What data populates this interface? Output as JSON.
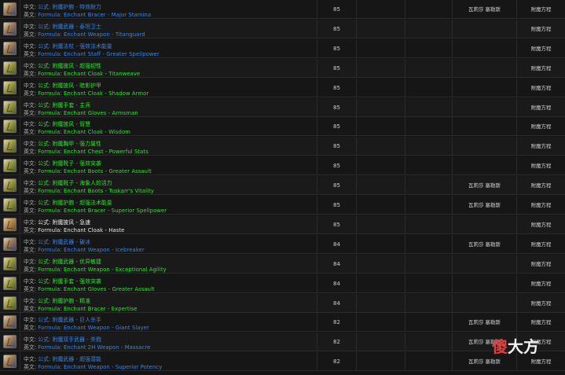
{
  "labels": {
    "cn_prefix": "中文:",
    "en_prefix": "英文:"
  },
  "rows": [
    {
      "cn": "公式: 附魔护腕 - 特效耐力",
      "en": "Formula: Enchant Bracer - Major Stamina",
      "level": "85",
      "source": "瓦莉莎 塞勒斯",
      "type": "附魔方程",
      "quality": "blue"
    },
    {
      "cn": "公式: 附魔武器 - 泰坦卫士",
      "en": "Formula: Enchant Weapon - Titanguard",
      "level": "85",
      "source": "",
      "type": "附魔方程",
      "quality": "blue"
    },
    {
      "cn": "公式: 附魔法杖 - 强效法术能量",
      "en": "Formula: Enchant Staff - Greater Spellpower",
      "level": "85",
      "source": "",
      "type": "附魔方程",
      "quality": "blue"
    },
    {
      "cn": "公式: 附魔披风 - 超强韧性",
      "en": "Formula: Enchant Cloak - Titanweave",
      "level": "85",
      "source": "",
      "type": "附魔方程",
      "quality": "green"
    },
    {
      "cn": "公式: 附魔披风 - 暗影护甲",
      "en": "Formula: Enchant Cloak - Shadow Armor",
      "level": "85",
      "source": "",
      "type": "附魔方程",
      "quality": "green"
    },
    {
      "cn": "公式: 附魔手套 - 主兵",
      "en": "Formula: Enchant Gloves - Armsman",
      "level": "85",
      "source": "",
      "type": "附魔方程",
      "quality": "green"
    },
    {
      "cn": "公式: 附魔披风 - 智慧",
      "en": "Formula: Enchant Cloak - Wisdom",
      "level": "85",
      "source": "",
      "type": "附魔方程",
      "quality": "green"
    },
    {
      "cn": "公式: 附魔胸甲 - 强力属性",
      "en": "Formula: Enchant Chest - Powerful Stats",
      "level": "85",
      "source": "",
      "type": "附魔方程",
      "quality": "green"
    },
    {
      "cn": "公式: 附魔靴子 - 强效突袭",
      "en": "Formula: Enchant Boots - Greater Assault",
      "level": "85",
      "source": "",
      "type": "附魔方程",
      "quality": "green"
    },
    {
      "cn": "公式: 附魔靴子 - 海象人的活力",
      "en": "Formula: Enchant Boots - Tuskarr's Vitality",
      "level": "85",
      "source": "瓦莉莎 塞勒斯",
      "type": "附魔方程",
      "quality": "green"
    },
    {
      "cn": "公式: 附魔护腕 - 超强法术能量",
      "en": "Formula: Enchant Bracer - Superior Spellpower",
      "level": "85",
      "source": "瓦莉莎 塞勒斯",
      "type": "附魔方程",
      "quality": "green"
    },
    {
      "cn": "公式: 附魔披风 - 急速",
      "en": "Formula: Enchant Cloak - Haste",
      "level": "85",
      "source": "",
      "type": "附魔方程",
      "quality": "white"
    },
    {
      "cn": "公式: 附魔武器 - 破冰",
      "en": "Formula: Enchant Weapon - Icebreaker",
      "level": "84",
      "source": "瓦莉莎 塞勒斯",
      "type": "附魔方程",
      "quality": "blue"
    },
    {
      "cn": "公式: 附魔武器 - 优异敏捷",
      "en": "Formula: Enchant Weapon - Exceptional Agility",
      "level": "84",
      "source": "",
      "type": "附魔方程",
      "quality": "green"
    },
    {
      "cn": "公式: 附魔手套 - 强效突袭",
      "en": "Formula: Enchant Gloves - Greater Assault",
      "level": "84",
      "source": "",
      "type": "附魔方程",
      "quality": "green"
    },
    {
      "cn": "公式: 附魔护腕 - 精准",
      "en": "Formula: Enchant Bracer - Expertise",
      "level": "84",
      "source": "",
      "type": "附魔方程",
      "quality": "green"
    },
    {
      "cn": "公式: 附魔武器 - 巨人杀手",
      "en": "Formula: Enchant Weapon - Giant Slayer",
      "level": "82",
      "source": "瓦莉莎 塞勒斯",
      "type": "附魔方程",
      "quality": "blue"
    },
    {
      "cn": "公式: 附魔双手武器 - 杀戮",
      "en": "Formula: Enchant 2H Weapon - Massacre",
      "level": "82",
      "source": "瓦莉莎 塞勒斯",
      "type": "附魔方程",
      "quality": "blue"
    },
    {
      "cn": "公式: 附魔武器 - 超强潜能",
      "en": "Formula: Enchant Weapon - Superior Potency",
      "level": "82",
      "source": "瓦莉莎 塞勒斯",
      "type": "附魔方程",
      "quality": "blue"
    }
  ],
  "watermark": {
    "part1": "傻",
    "part2": "大方"
  }
}
